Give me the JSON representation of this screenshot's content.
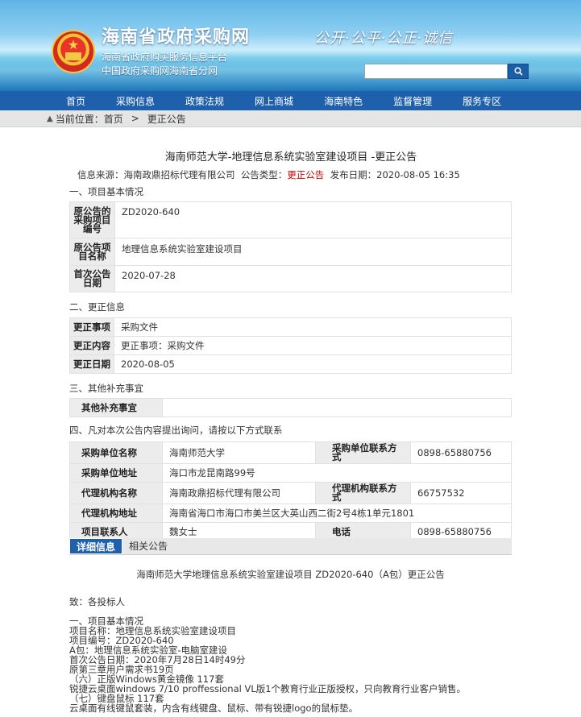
{
  "header": {
    "site_title": "海南省政府采购网",
    "subtitle1": "海南省政府购买服务信息平台",
    "subtitle2": "中国政府采购网海南省分网",
    "slogan": "公开·公平·公正·诚信",
    "search_placeholder": ""
  },
  "nav": {
    "items": [
      "首页",
      "采购信息",
      "政策法规",
      "网上商城",
      "海南特色",
      "监督管理",
      "服务专区"
    ]
  },
  "breadcrumb": {
    "prefix": "当前位置：",
    "home": "首页",
    "separator": ">",
    "current": "更正公告"
  },
  "notice": {
    "title": "海南师范大学-地理信息系统实验室建设项目 -更正公告",
    "source_label": "信息来源：",
    "source": "海南政鼎招标代理有限公司",
    "type_label": "公告类型：",
    "type": "更正公告",
    "date_label": "发布日期：",
    "date": "2020-08-05 16:35"
  },
  "sections": {
    "s1": "一、项目基本情况",
    "s2": "二、更正信息",
    "s3": "三、其他补充事宜",
    "s4": "四、凡对本次公告内容提出询问，请按以下方式联系"
  },
  "basic_info": [
    {
      "label": "原公告的采购项目编号",
      "value": "ZD2020-640"
    },
    {
      "label": "原公告项目名称",
      "value": "地理信息系统实验室建设项目"
    },
    {
      "label": "首次公告日期",
      "value": "2020-07-28"
    }
  ],
  "correction_info": [
    {
      "label": "更正事项",
      "value": "采购文件"
    },
    {
      "label": "更正内容",
      "value": "更正事项：采购文件"
    },
    {
      "label": "更正日期",
      "value": "2020-08-05"
    }
  ],
  "other": {
    "label": "其他补充事宜",
    "value": ""
  },
  "contact": [
    {
      "l1": "采购单位名称",
      "v1": "海南师范大学",
      "l2": "采购单位联系方式",
      "v2": "0898-65880756"
    },
    {
      "l1": "采购单位地址",
      "v1": "海口市龙昆南路99号"
    },
    {
      "l1": "代理机构名称",
      "v1": "海南政鼎招标代理有限公司",
      "l2": "代理机构联系方式",
      "v2": "66757532"
    },
    {
      "l1": "代理机构地址",
      "v1": "海南省海口市海口市美兰区大英山西二街2号4栋1单元1801"
    },
    {
      "l1": "项目联系人",
      "v1": "魏女士",
      "l2": "电话",
      "v2": "0898-65880756"
    }
  ],
  "tabs": [
    "详细信息",
    "相关公告"
  ],
  "detail": {
    "heading": "海南师范大学地理信息系统实验室建设项目 ZD2020-640（A包）更正公告",
    "greeting": "致：各投标人",
    "lines": [
      "一、项目基本情况",
      "项目名称：地理信息系统实验室建设项目",
      "项目编号：ZD2020-640",
      "A包：地理信息系统实验室-电脑室建设",
      "首次公告日期：2020年7月28日14时49分",
      "原第三章用户需求书19页",
      "（六）正版Windows黄金镜像    117套",
      "锐捷云桌面windows 7/10 proffessional VL版1个教育行业正版授权，只向教育行业客户销售。",
      "（七）键盘鼠标    117套",
      "云桌面有线键鼠套装，内含有线键盘、鼠标、带有锐捷logo的鼠标垫。"
    ]
  },
  "colors": {
    "nav_bg": "#1f60ad",
    "notice_type": "#cc0000"
  }
}
